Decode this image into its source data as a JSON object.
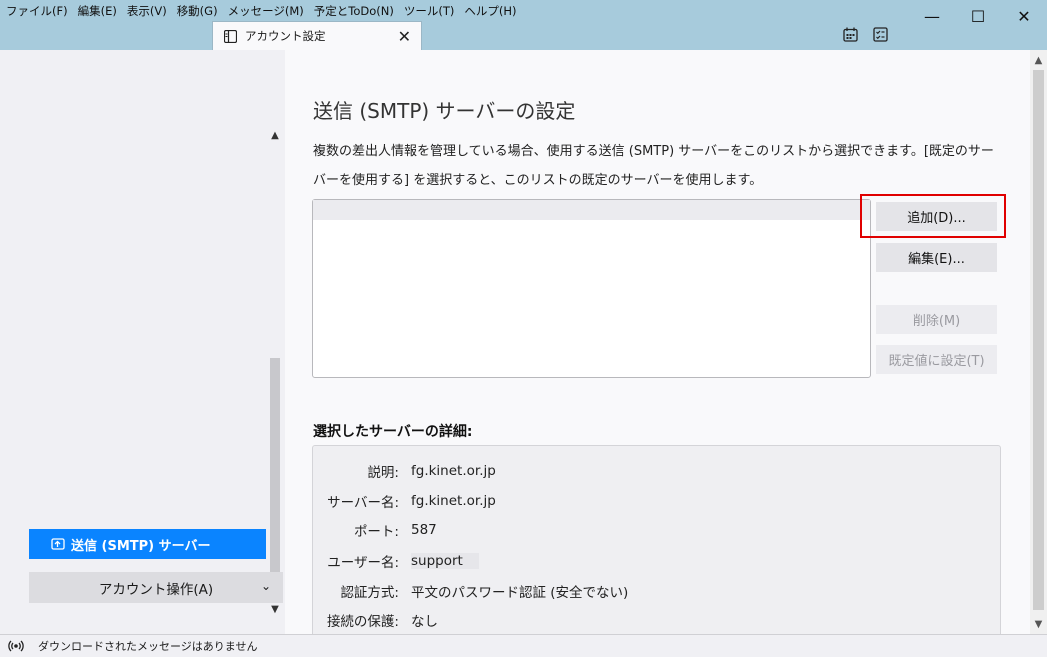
{
  "menubar": {
    "items": [
      "ファイル(F)",
      "編集(E)",
      "表示(V)",
      "移動(G)",
      "メッセージ(M)",
      "予定とToDo(N)",
      "ツール(T)",
      "ヘルプ(H)"
    ]
  },
  "window": {
    "minimize": "—",
    "maximize": "☐",
    "close": "✕"
  },
  "tab": {
    "label": "アカウント設定",
    "close": "✕",
    "icon": "settings-page-icon"
  },
  "toolbar": {
    "icons": [
      "calendar-icon",
      "tasks-icon"
    ]
  },
  "sidebar": {
    "scroll_up": "▲",
    "scroll_down": "▼",
    "selected_item": "送信 (SMTP) サーバー",
    "selected_icon": "outgoing-server-icon",
    "account_actions": "アカウント操作(A)",
    "account_actions_chevron": "⌄"
  },
  "main": {
    "title": "送信 (SMTP) サーバーの設定",
    "description_1": "複数の差出人情報を管理している場合、使用する送信 (SMTP) サーバーをこのリストから選択できます。[既定のサー",
    "description_2": "バーを使用する] を選択すると、このリストの既定のサーバーを使用します。",
    "buttons": {
      "add": "追加(D)...",
      "edit": "編集(E)...",
      "delete": "削除(M)",
      "set_default": "既定値に設定(T)"
    },
    "details_title": "選択したサーバーの詳細:",
    "details": [
      {
        "key": "説明:",
        "value": "fg.kinet.or.jp"
      },
      {
        "key": "サーバー名:",
        "value": "fg.kinet.or.jp"
      },
      {
        "key": "ポート:",
        "value": "587"
      },
      {
        "key": "ユーザー名:",
        "value": "support"
      },
      {
        "key": "認証方式:",
        "value": "平文のパスワード認証 (安全でない)"
      },
      {
        "key": "接続の保護:",
        "value": "なし"
      }
    ]
  },
  "statusbar": {
    "text": "ダウンロードされたメッセージはありません",
    "icon": "broadcast-icon"
  },
  "colors": {
    "titlebar": "#a7cbdc",
    "accent": "#0a84ff",
    "highlight": "#e00000"
  }
}
